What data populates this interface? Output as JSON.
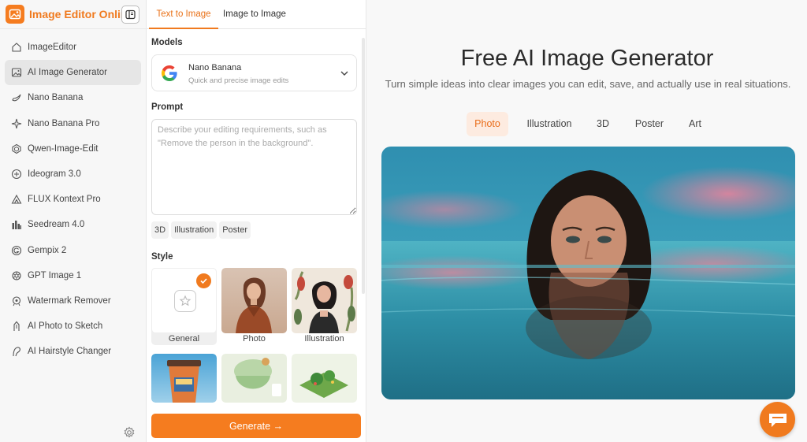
{
  "brand": {
    "name": "Image Editor Online",
    "accent": "#f07a1e"
  },
  "sidebar": {
    "items": [
      {
        "label": "ImageEditor",
        "icon": "home-icon",
        "active": false
      },
      {
        "label": "AI Image Generator",
        "icon": "image-icon",
        "active": true
      },
      {
        "label": "Nano Banana",
        "icon": "banana-icon",
        "active": false
      },
      {
        "label": "Nano Banana Pro",
        "icon": "sparkle-icon",
        "active": false
      },
      {
        "label": "Qwen-Image-Edit",
        "icon": "qwen-icon",
        "active": false
      },
      {
        "label": "Ideogram 3.0",
        "icon": "ideogram-icon",
        "active": false
      },
      {
        "label": "FLUX Kontext Pro",
        "icon": "flux-icon",
        "active": false
      },
      {
        "label": "Seedream 4.0",
        "icon": "bars-icon",
        "active": false
      },
      {
        "label": "Gempix 2",
        "icon": "gempix-icon",
        "active": false
      },
      {
        "label": "GPT Image 1",
        "icon": "openai-icon",
        "active": false
      },
      {
        "label": "Watermark Remover",
        "icon": "watermark-icon",
        "active": false
      },
      {
        "label": "AI Photo to Sketch",
        "icon": "pen-icon",
        "active": false
      },
      {
        "label": "AI Hairstyle Changer",
        "icon": "hairstyle-icon",
        "active": false
      }
    ]
  },
  "panel": {
    "tabs": [
      "Text to Image",
      "Image to Image"
    ],
    "models_label": "Models",
    "model": {
      "name": "Nano Banana",
      "description": "Quick and precise image edits"
    },
    "prompt_label": "Prompt",
    "prompt_placeholder": "Describe your editing requirements, such as \"Remove the person in the background\".",
    "chips": [
      "3D",
      "Illustration",
      "Poster"
    ],
    "style_label": "Style",
    "styles": [
      {
        "label": "General",
        "selected": true
      },
      {
        "label": "Photo",
        "selected": false
      },
      {
        "label": "Illustration",
        "selected": false
      }
    ],
    "generate_label": "Generate →"
  },
  "main": {
    "title": "Free AI Image Generator",
    "subtitle": "Turn simple ideas into clear images you can edit, save, and actually use in real situations.",
    "categories": [
      "Photo",
      "Illustration",
      "3D",
      "Poster",
      "Art"
    ],
    "active_category": "Photo"
  }
}
